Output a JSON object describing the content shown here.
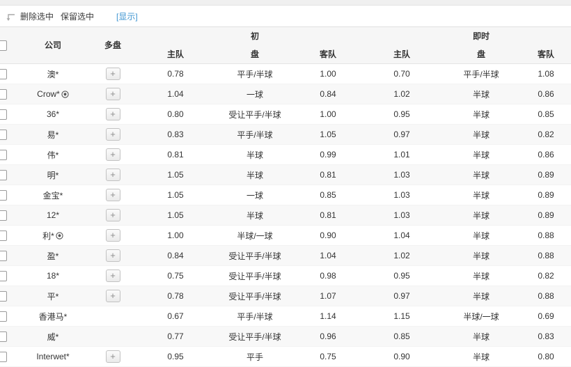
{
  "toolbar": {
    "delete_label": "删除选中",
    "keep_label": "保留选中",
    "show_label": "[显示]"
  },
  "table": {
    "headers": {
      "company": "公司",
      "multi": "多盘",
      "home": "主队",
      "away": "客队",
      "initial_line1": "初",
      "initial_line2": "盘",
      "live_line1": "即时",
      "live_line2": "盘"
    },
    "rows": [
      {
        "company": "澳*",
        "ball": false,
        "multi": true,
        "init_home": "0.78",
        "init_handicap": "平手/半球",
        "init_away": "1.00",
        "live_home": "0.70",
        "live_handicap": "平手/半球",
        "live_away": "1.08"
      },
      {
        "company": "Crow*",
        "ball": true,
        "multi": true,
        "init_home": "1.04",
        "init_handicap": "一球",
        "init_away": "0.84",
        "live_home": "1.02",
        "live_handicap": "半球",
        "live_away": "0.86"
      },
      {
        "company": "36*",
        "ball": false,
        "multi": true,
        "init_home": "0.80",
        "init_handicap": "受让平手/半球",
        "init_away": "1.00",
        "live_home": "0.95",
        "live_handicap": "半球",
        "live_away": "0.85"
      },
      {
        "company": "易*",
        "ball": false,
        "multi": true,
        "init_home": "0.83",
        "init_handicap": "平手/半球",
        "init_away": "1.05",
        "live_home": "0.97",
        "live_handicap": "半球",
        "live_away": "0.82"
      },
      {
        "company": "伟*",
        "ball": false,
        "multi": true,
        "init_home": "0.81",
        "init_handicap": "半球",
        "init_away": "0.99",
        "live_home": "1.01",
        "live_handicap": "半球",
        "live_away": "0.86"
      },
      {
        "company": "明*",
        "ball": false,
        "multi": true,
        "init_home": "1.05",
        "init_handicap": "半球",
        "init_away": "0.81",
        "live_home": "1.03",
        "live_handicap": "半球",
        "live_away": "0.89"
      },
      {
        "company": "金宝*",
        "ball": false,
        "multi": true,
        "init_home": "1.05",
        "init_handicap": "一球",
        "init_away": "0.85",
        "live_home": "1.03",
        "live_handicap": "半球",
        "live_away": "0.89"
      },
      {
        "company": "12*",
        "ball": false,
        "multi": true,
        "init_home": "1.05",
        "init_handicap": "半球",
        "init_away": "0.81",
        "live_home": "1.03",
        "live_handicap": "半球",
        "live_away": "0.89"
      },
      {
        "company": "利*",
        "ball": true,
        "multi": true,
        "init_home": "1.00",
        "init_handicap": "半球/一球",
        "init_away": "0.90",
        "live_home": "1.04",
        "live_handicap": "半球",
        "live_away": "0.88"
      },
      {
        "company": "盈*",
        "ball": false,
        "multi": true,
        "init_home": "0.84",
        "init_handicap": "受让平手/半球",
        "init_away": "1.04",
        "live_home": "1.02",
        "live_handicap": "半球",
        "live_away": "0.88"
      },
      {
        "company": "18*",
        "ball": false,
        "multi": true,
        "init_home": "0.75",
        "init_handicap": "受让平手/半球",
        "init_away": "0.98",
        "live_home": "0.95",
        "live_handicap": "半球",
        "live_away": "0.82"
      },
      {
        "company": "平*",
        "ball": false,
        "multi": true,
        "init_home": "0.78",
        "init_handicap": "受让平手/半球",
        "init_away": "1.07",
        "live_home": "0.97",
        "live_handicap": "半球",
        "live_away": "0.88"
      },
      {
        "company": "香港马*",
        "ball": false,
        "multi": false,
        "init_home": "0.67",
        "init_handicap": "平手/半球",
        "init_away": "1.14",
        "live_home": "1.15",
        "live_handicap": "半球/一球",
        "live_away": "0.69"
      },
      {
        "company": "威*",
        "ball": false,
        "multi": false,
        "init_home": "0.77",
        "init_handicap": "受让平手/半球",
        "init_away": "0.96",
        "live_home": "0.85",
        "live_handicap": "半球",
        "live_away": "0.83"
      },
      {
        "company": "Interwet*",
        "ball": false,
        "multi": true,
        "init_home": "0.95",
        "init_handicap": "平手",
        "init_away": "0.75",
        "live_home": "0.90",
        "live_handicap": "半球",
        "live_away": "0.80"
      }
    ]
  },
  "colors": {
    "link_blue": "#3d94d1",
    "header_bg": "#f6f6f6",
    "alt_row_bg": "#f8f8f8"
  }
}
